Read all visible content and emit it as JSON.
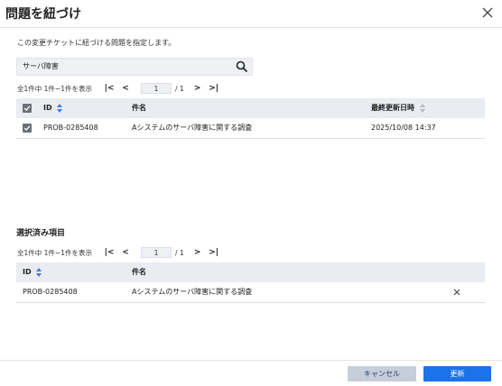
{
  "dialog": {
    "title": "問題を紐づけ",
    "description": "この変更チケットに紐づける問題を指定します。"
  },
  "search": {
    "value": "サーバ障害"
  },
  "results": {
    "pager": {
      "count": "全1件中 1件~1件を表示",
      "page": "1",
      "total": "/ 1"
    },
    "columns": {
      "id": "ID",
      "subject": "件名",
      "updated": "最終更新日時"
    },
    "rows": [
      {
        "id": "PROB-0285408",
        "subject": "Aシステムのサーバ障害に関する調査",
        "updated": "2025/10/08 14:37",
        "checked": true
      }
    ]
  },
  "selected": {
    "heading": "選択済み項目",
    "pager": {
      "count": "全1件中 1件~1件を表示",
      "page": "1",
      "total": "/ 1"
    },
    "columns": {
      "id": "ID",
      "subject": "件名"
    },
    "rows": [
      {
        "id": "PROB-0285408",
        "subject": "Aシステムのサーバ障害に関する調査"
      }
    ]
  },
  "footer": {
    "cancel_label": "キャンセル",
    "update_label": "更新"
  },
  "colors": {
    "primary": "#1a73e8",
    "cancel_bg": "#c6cedb",
    "header_bg": "#e9ecf0"
  },
  "icons": {
    "pager_first": "⏮",
    "pager_prev": "‹",
    "pager_next": "›",
    "pager_last": "⏭"
  }
}
